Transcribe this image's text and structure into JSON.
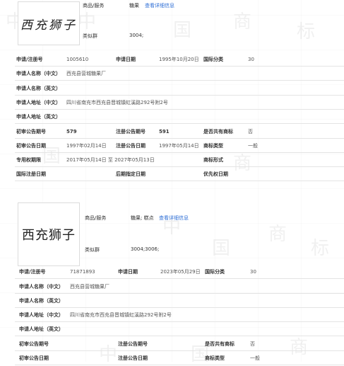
{
  "card1": {
    "logo_text": "西充狮子",
    "goods_label": "商品/服务",
    "goods_value": "糖果",
    "detail_link": "查看详细信息",
    "class_label": "类似群",
    "class_value": "3004;",
    "reg_no_label": "申请/注册号",
    "reg_no": "1005610",
    "app_date_label": "申请日期",
    "app_date": "1995年10月20日",
    "intl_class_label": "国际分类",
    "intl_class": "30",
    "applicant_cn_label": "申请人名称（中文）",
    "applicant_cn": "西充县营城糖果厂",
    "applicant_en_label": "申请人名称（英文）",
    "address_cn_label": "申请人地址（中文）",
    "address_cn": "四川省南充市西充县晋城镇虹溪路292号附2号",
    "address_en_label": "申请人地址（英文）",
    "first_pub_no_label": "初审公告期号",
    "first_pub_no": "579",
    "reg_pub_no_label": "注册公告期号",
    "reg_pub_no": "591",
    "shared_label": "是否共有商标",
    "shared": "否",
    "first_pub_date_label": "初审公告日期",
    "first_pub_date": "1997年02月14日",
    "reg_pub_date_label": "注册公告日期",
    "reg_pub_date": "1997年05月14日",
    "tm_type_label": "商标类型",
    "tm_type": "一般",
    "exclusive_label": "专用权期限",
    "exclusive": "2017年05月14日 至 2027年05月13日",
    "tm_form_label": "商标形式",
    "intl_reg_date_label": "国际注册日期",
    "later_date_label": "后期指定日期",
    "priority_date_label": "优先权日期"
  },
  "card2": {
    "logo_text": "西充狮子",
    "goods_label": "商品/服务",
    "goods_value": "糖果; 糕点",
    "detail_link": "查看详细信息",
    "class_label": "类似群",
    "class_value": "3004;3006;",
    "reg_no_label": "申请/注册号",
    "reg_no": "71871893",
    "app_date_label": "申请日期",
    "app_date": "2023年05月29日",
    "intl_class_label": "国际分类",
    "intl_class": "30",
    "applicant_cn_label": "申请人名称（中文）",
    "applicant_cn": "西充县营城糖果厂",
    "applicant_en_label": "申请人名称（英文）",
    "address_cn_label": "申请人地址（中文）",
    "address_cn": "四川省南充市西充县晋城镇虹溪路292号附2号",
    "address_en_label": "申请人地址（英文）",
    "first_pub_no_label": "初审公告期号",
    "reg_pub_no_label": "注册公告期号",
    "shared_label": "是否共有商标",
    "shared": "否",
    "first_pub_date_label": "初审公告日期",
    "reg_pub_date_label": "注册公告日期",
    "tm_type_label": "商标类型",
    "tm_type": "一般"
  },
  "watermark": [
    "中",
    "国",
    "商",
    "标"
  ]
}
